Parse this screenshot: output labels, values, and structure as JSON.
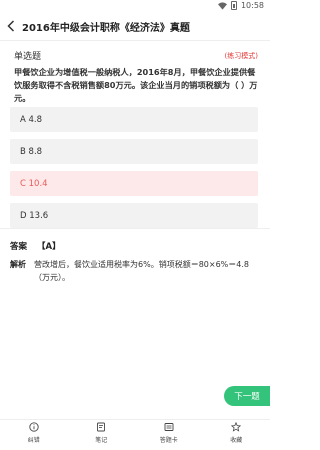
{
  "status_bar": {
    "time": "10:58"
  },
  "header": {
    "title": "2016年中级会计职称《经济法》真题"
  },
  "question": {
    "type": "单选题",
    "mode": "(练习模式)",
    "text": "甲餐饮企业为增值税一般纳税人，2016年8月，甲餐饮企业提供餐饮服务取得不含税销售额80万元。该企业当月的销项税额为（    ）万元。"
  },
  "options": [
    {
      "label": "A  4.8",
      "state": "normal"
    },
    {
      "label": "B  8.8",
      "state": "normal"
    },
    {
      "label": "C  10.4",
      "state": "wrong"
    },
    {
      "label": "D  13.6",
      "state": "normal"
    }
  ],
  "answer": {
    "label": "答案",
    "value": "【A】"
  },
  "analysis": {
    "label": "解析",
    "text": "营改增后，餐饮业适用税率为6%。销项税额＝80×6%＝4.8（万元）。"
  },
  "next_label": "下一题",
  "bottom_tabs": [
    {
      "label": "纠错",
      "icon": "info-icon"
    },
    {
      "label": "笔记",
      "icon": "note-icon"
    },
    {
      "label": "答题卡",
      "icon": "answer-card-icon"
    },
    {
      "label": "收藏",
      "icon": "star-icon"
    }
  ],
  "colors": {
    "accent_green": "#34c37a",
    "wrong_red": "#e85a5a"
  }
}
